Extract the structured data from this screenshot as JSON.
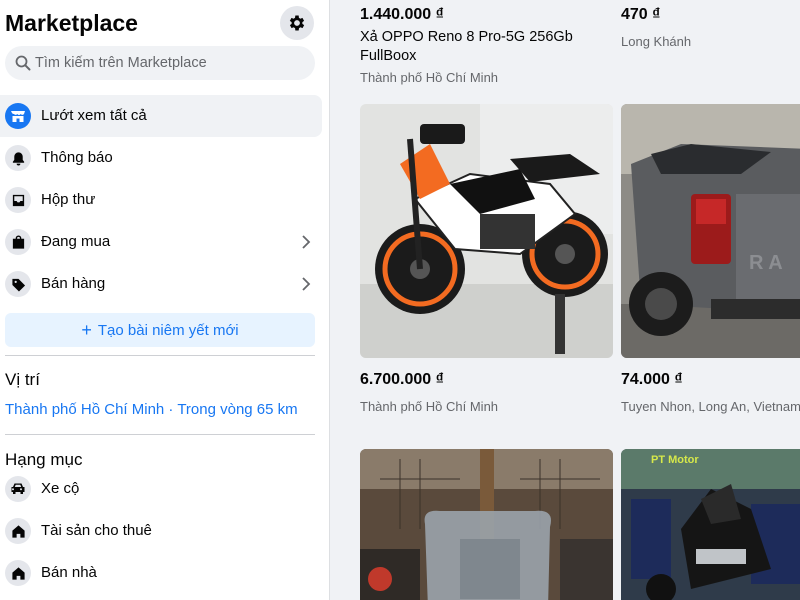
{
  "sidebar": {
    "title": "Marketplace",
    "search_placeholder": "Tìm kiếm trên Marketplace",
    "items": [
      {
        "label": "Lướt xem tất cả",
        "icon": "storefront-icon"
      },
      {
        "label": "Thông báo",
        "icon": "bell-icon"
      },
      {
        "label": "Hộp thư",
        "icon": "inbox-icon"
      },
      {
        "label": "Đang mua",
        "icon": "shopping-bag-icon"
      },
      {
        "label": "Bán hàng",
        "icon": "price-tag-icon"
      }
    ],
    "create_listing": "Tạo bài niêm yết mới",
    "location_heading": "Vị trí",
    "location_value": "Thành phố Hồ Chí Minh · Trong vòng 65 km",
    "categories_heading": "Hạng mục",
    "categories": [
      {
        "label": "Xe cộ",
        "icon": "car-icon"
      },
      {
        "label": "Tài sản cho thuê",
        "icon": "house-key-icon"
      },
      {
        "label": "Bán nhà",
        "icon": "house-icon"
      }
    ]
  },
  "listings": [
    {
      "price": "1.440.000 ₫",
      "title": "Xả OPPO Reno 8 Pro-5G 256Gb FullBoox",
      "location": "Thành phố Hồ Chí Minh"
    },
    {
      "price": "470 ₫",
      "title": "",
      "location": "Long Khánh"
    },
    {
      "price": "6.700.000 ₫",
      "title": "",
      "location": "Thành phố Hồ Chí Minh",
      "image": "motorcycle"
    },
    {
      "price": "74.000 ₫",
      "title": "",
      "location": "Tuyen Nhon, Long An, Vietnam",
      "image": "pickup-truck"
    },
    {
      "image": "guitar-shop"
    },
    {
      "image": "motorcycle-showroom",
      "image_text": "PT Motor"
    }
  ],
  "colors": {
    "accent": "#1877f2",
    "accent_light": "#e7f3ff",
    "muted": "#65676b",
    "page_bg": "#f0f2f5"
  }
}
